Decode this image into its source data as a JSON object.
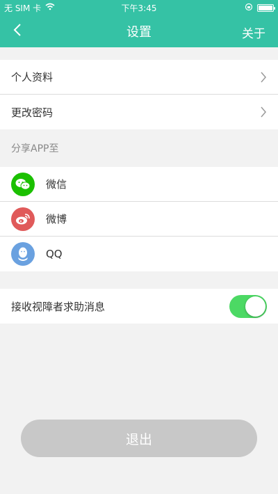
{
  "status": {
    "carrier": "无 SIM 卡",
    "time": "下午3:45"
  },
  "nav": {
    "title": "设置",
    "right": "关于"
  },
  "account": {
    "items": [
      {
        "label": "个人资料"
      },
      {
        "label": "更改密码"
      }
    ]
  },
  "share": {
    "label": "分享APP至",
    "items": [
      {
        "label": "微信",
        "icon": "wechat-icon",
        "color": "#1bc000"
      },
      {
        "label": "微博",
        "icon": "weibo-icon",
        "color": "#e05a5a"
      },
      {
        "label": "QQ",
        "icon": "qq-icon",
        "color": "#6aa1e0"
      }
    ]
  },
  "notify": {
    "label": "接收视障者求助消息",
    "enabled": true
  },
  "logout": {
    "label": "退出"
  },
  "colors": {
    "accent": "#35c2a5",
    "toggle_on": "#4cd964",
    "logout_bg": "#c8c8c8"
  }
}
